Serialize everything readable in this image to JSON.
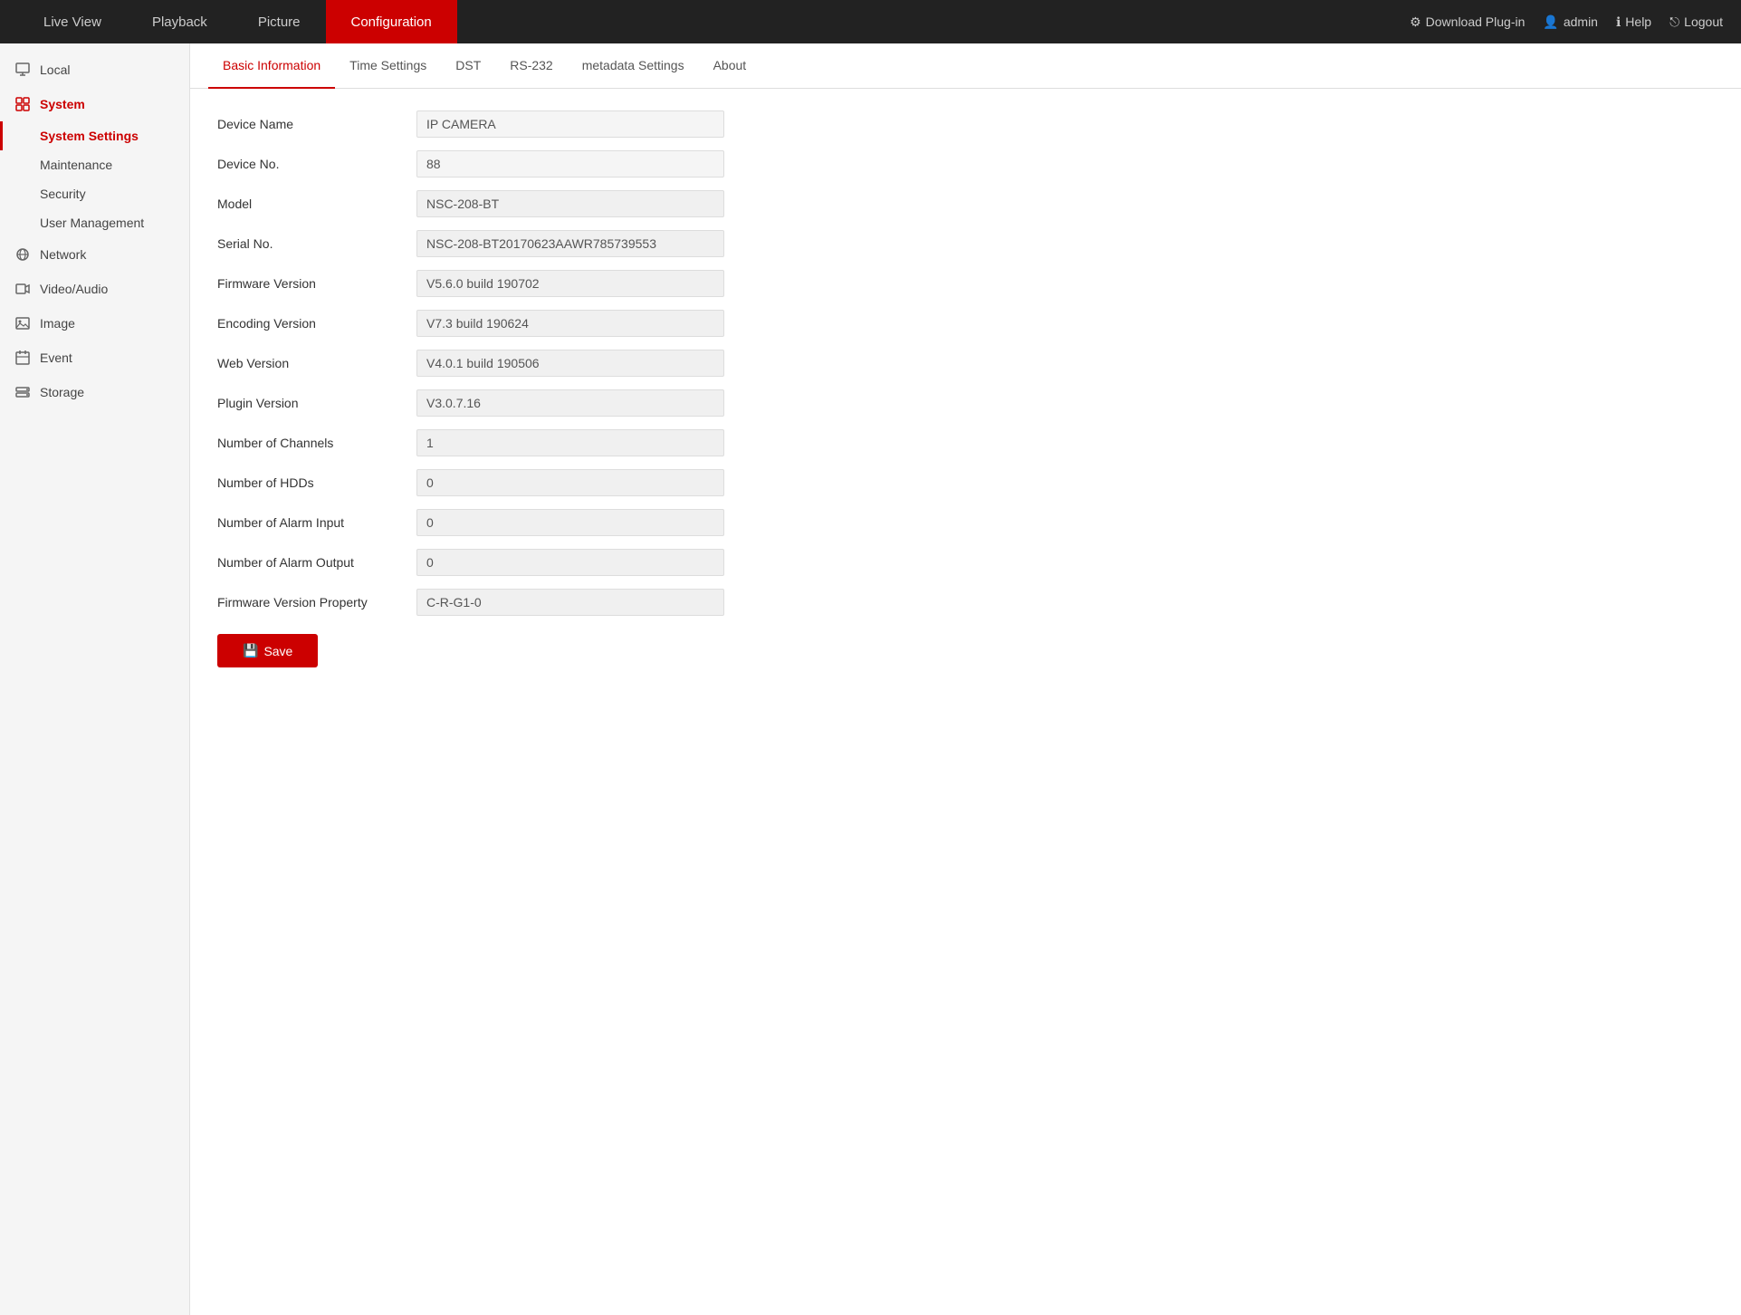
{
  "topNav": {
    "links": [
      {
        "id": "live-view",
        "label": "Live View",
        "active": false
      },
      {
        "id": "playback",
        "label": "Playback",
        "active": false
      },
      {
        "id": "picture",
        "label": "Picture",
        "active": false
      },
      {
        "id": "configuration",
        "label": "Configuration",
        "active": true
      }
    ],
    "right": [
      {
        "id": "download-plugin",
        "icon": "plug-icon",
        "label": "Download Plug-in"
      },
      {
        "id": "admin",
        "icon": "user-icon",
        "label": "admin"
      },
      {
        "id": "help",
        "icon": "info-icon",
        "label": "Help"
      },
      {
        "id": "logout",
        "icon": "logout-icon",
        "label": "Logout"
      }
    ]
  },
  "sidebar": {
    "items": [
      {
        "id": "local",
        "icon": "monitor-icon",
        "label": "Local",
        "active": false
      },
      {
        "id": "system",
        "icon": "system-icon",
        "label": "System",
        "active": true,
        "children": [
          {
            "id": "system-settings",
            "label": "System Settings",
            "active": true
          },
          {
            "id": "maintenance",
            "label": "Maintenance",
            "active": false
          },
          {
            "id": "security",
            "label": "Security",
            "active": false
          },
          {
            "id": "user-management",
            "label": "User Management",
            "active": false
          }
        ]
      },
      {
        "id": "network",
        "icon": "network-icon",
        "label": "Network",
        "active": false
      },
      {
        "id": "video-audio",
        "icon": "video-icon",
        "label": "Video/Audio",
        "active": false
      },
      {
        "id": "image",
        "icon": "image-icon",
        "label": "Image",
        "active": false
      },
      {
        "id": "event",
        "icon": "event-icon",
        "label": "Event",
        "active": false
      },
      {
        "id": "storage",
        "icon": "storage-icon",
        "label": "Storage",
        "active": false
      }
    ]
  },
  "tabs": [
    {
      "id": "basic-information",
      "label": "Basic Information",
      "active": true
    },
    {
      "id": "time-settings",
      "label": "Time Settings",
      "active": false
    },
    {
      "id": "dst",
      "label": "DST",
      "active": false
    },
    {
      "id": "rs-232",
      "label": "RS-232",
      "active": false
    },
    {
      "id": "metadata-settings",
      "label": "metadata Settings",
      "active": false
    },
    {
      "id": "about",
      "label": "About",
      "active": false
    }
  ],
  "form": {
    "fields": [
      {
        "id": "device-name",
        "label": "Device Name",
        "value": "IP CAMERA",
        "readonly": false
      },
      {
        "id": "device-no",
        "label": "Device No.",
        "value": "88",
        "readonly": false
      },
      {
        "id": "model",
        "label": "Model",
        "value": "NSC-208-BT",
        "readonly": true
      },
      {
        "id": "serial-no",
        "label": "Serial No.",
        "value": "NSC-208-BT20170623AAWR785739553",
        "readonly": true
      },
      {
        "id": "firmware-version",
        "label": "Firmware Version",
        "value": "V5.6.0 build 190702",
        "readonly": true
      },
      {
        "id": "encoding-version",
        "label": "Encoding Version",
        "value": "V7.3 build 190624",
        "readonly": true
      },
      {
        "id": "web-version",
        "label": "Web Version",
        "value": "V4.0.1 build 190506",
        "readonly": true
      },
      {
        "id": "plugin-version",
        "label": "Plugin Version",
        "value": "V3.0.7.16",
        "readonly": true
      },
      {
        "id": "number-of-channels",
        "label": "Number of Channels",
        "value": "1",
        "readonly": true
      },
      {
        "id": "number-of-hdds",
        "label": "Number of HDDs",
        "value": "0",
        "readonly": true
      },
      {
        "id": "number-of-alarm-input",
        "label": "Number of Alarm Input",
        "value": "0",
        "readonly": true
      },
      {
        "id": "number-of-alarm-output",
        "label": "Number of Alarm Output",
        "value": "0",
        "readonly": true
      },
      {
        "id": "firmware-version-property",
        "label": "Firmware Version Property",
        "value": "C-R-G1-0",
        "readonly": true
      }
    ],
    "saveButton": "Save"
  }
}
